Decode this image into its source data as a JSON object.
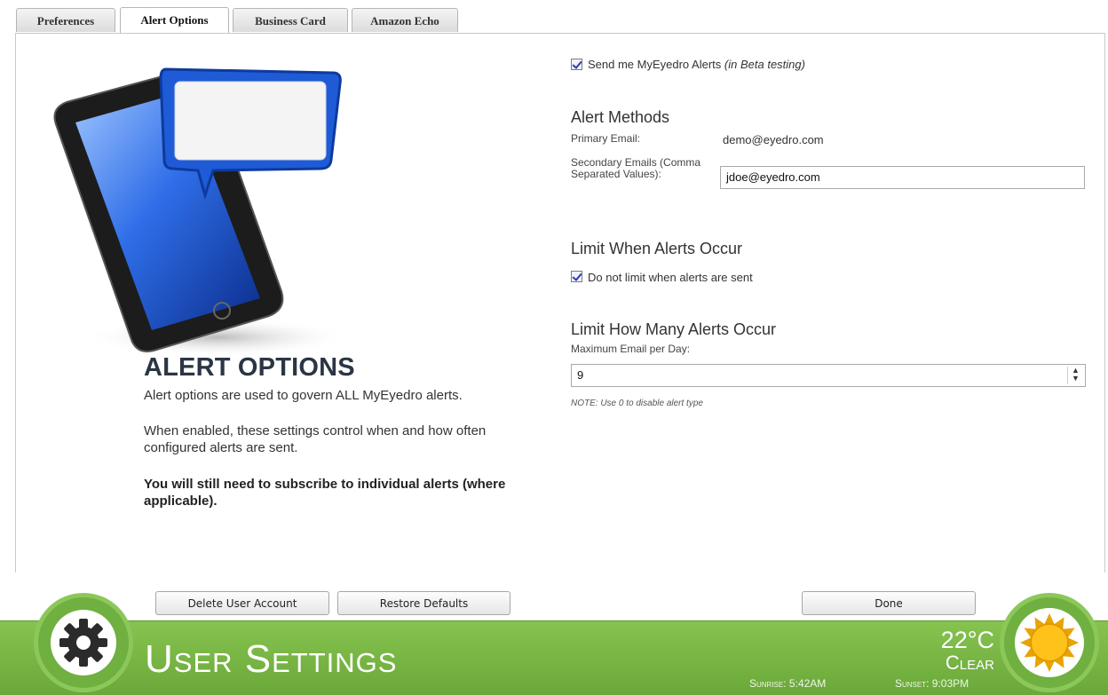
{
  "tabs": [
    {
      "label": "Preferences",
      "active": false
    },
    {
      "label": "Alert Options",
      "active": true
    },
    {
      "label": "Business Card",
      "active": false
    },
    {
      "label": "Amazon Echo",
      "active": false
    }
  ],
  "left": {
    "title": "ALERT OPTIONS",
    "p1": "Alert options are used to govern ALL MyEyedro alerts.",
    "p2": "When enabled, these settings control when and how often configured alerts are sent.",
    "p3": "You will still need to subscribe to individual alerts (where applicable)."
  },
  "form": {
    "send_alerts_label": "Send me MyEyedro Alerts",
    "send_alerts_note": "(in Beta testing)",
    "send_alerts_checked": true,
    "alert_methods_heading": "Alert Methods",
    "primary_email_label": "Primary Email:",
    "primary_email_value": "demo@eyedro.com",
    "secondary_emails_label": "Secondary Emails (Comma Separated Values):",
    "secondary_emails_value": "jdoe@eyedro.com",
    "limit_when_heading": "Limit When Alerts Occur",
    "no_limit_label": "Do not limit when alerts are sent",
    "no_limit_checked": true,
    "limit_many_heading": "Limit How Many Alerts Occur",
    "max_email_label": "Maximum Email per Day:",
    "max_email_value": "9",
    "note": "NOTE: Use 0 to disable alert type"
  },
  "buttons": {
    "delete": "Delete User Account",
    "restore": "Restore Defaults",
    "done": "Done"
  },
  "footer": {
    "title": "User Settings",
    "temperature": "22°C",
    "condition": "Clear",
    "sunrise": "Sunrise: 5:42AM",
    "sunset": "Sunset: 9:03PM"
  },
  "colors": {
    "footer_green": "#78b845",
    "heading": "#2b3544",
    "phone_blue": "#1f5bd6"
  },
  "icons": [
    "gear-icon",
    "sun-icon",
    "phone-illustration",
    "speech-bubble",
    "spinner-arrows-icon"
  ]
}
